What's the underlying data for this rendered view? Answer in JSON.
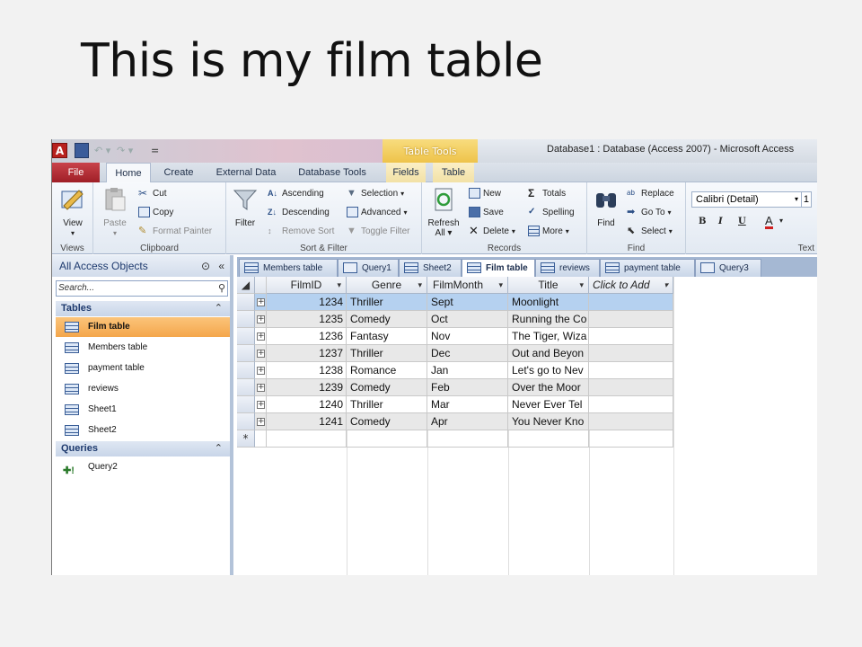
{
  "slide": {
    "title": "This is my film table"
  },
  "window": {
    "title": "Database1 : Database (Access 2007)  -  Microsoft Access",
    "contextual_tab_group": "Table Tools",
    "quick_access": {
      "app_icon": "A",
      "more": "="
    }
  },
  "ribbon_tabs": [
    "File",
    "Home",
    "Create",
    "External Data",
    "Database Tools",
    "Fields",
    "Table"
  ],
  "ribbon": {
    "views": {
      "label": "Views",
      "view": "View"
    },
    "clipboard": {
      "label": "Clipboard",
      "paste": "Paste",
      "cut": "Cut",
      "copy": "Copy",
      "format_painter": "Format Painter"
    },
    "sort_filter": {
      "label": "Sort & Filter",
      "filter": "Filter",
      "ascending": "Ascending",
      "descending": "Descending",
      "remove_sort": "Remove Sort",
      "selection": "Selection",
      "advanced": "Advanced",
      "toggle_filter": "Toggle Filter"
    },
    "records": {
      "label": "Records",
      "refresh": "Refresh",
      "refresh_all": "All",
      "new": "New",
      "save": "Save",
      "delete": "Delete",
      "totals": "Totals",
      "spelling": "Spelling",
      "more": "More"
    },
    "find": {
      "label": "Find",
      "find": "Find",
      "replace": "Replace",
      "goto": "Go To",
      "select": "Select"
    },
    "text": {
      "label": "Text",
      "font": "Calibri (Detail)",
      "size": "1",
      "bold": "B",
      "italic": "I",
      "underline": "U",
      "font_color": "A"
    }
  },
  "nav": {
    "header": "All Access Objects",
    "search_placeholder": "Search...",
    "tables_label": "Tables",
    "tables": [
      "Film table",
      "Members table",
      "payment table",
      "reviews",
      "Sheet1",
      "Sheet2"
    ],
    "queries_label": "Queries",
    "queries": [
      "Query2"
    ]
  },
  "object_tabs": [
    "Members table",
    "Query1",
    "Sheet2",
    "Film table",
    "reviews",
    "payment table",
    "Query3"
  ],
  "datasheet": {
    "columns": [
      "FilmID",
      "Genre",
      "FilmMonth",
      "Title",
      "Click to Add"
    ],
    "rows": [
      [
        "1234",
        "Thriller",
        "Sept",
        "Moonlight"
      ],
      [
        "1235",
        "Comedy",
        "Oct",
        "Running the Co"
      ],
      [
        "1236",
        "Fantasy",
        "Nov",
        "The Tiger, Wiza"
      ],
      [
        "1237",
        "Thriller",
        "Dec",
        "Out and Beyon"
      ],
      [
        "1238",
        "Romance",
        "Jan",
        "Let's go to Nev"
      ],
      [
        "1239",
        "Comedy",
        "Feb",
        "Over the Moor"
      ],
      [
        "1240",
        "Thriller",
        "Mar",
        "Never Ever Tel"
      ],
      [
        "1241",
        "Comedy",
        "Apr",
        "You Never Kno"
      ]
    ],
    "new_row_marker": "*"
  },
  "colors": {
    "file_tab": "#b0262d",
    "table_tools": "#eec34a",
    "active_nav": "#f4a64b",
    "selected_row": "#b5d1f0"
  }
}
